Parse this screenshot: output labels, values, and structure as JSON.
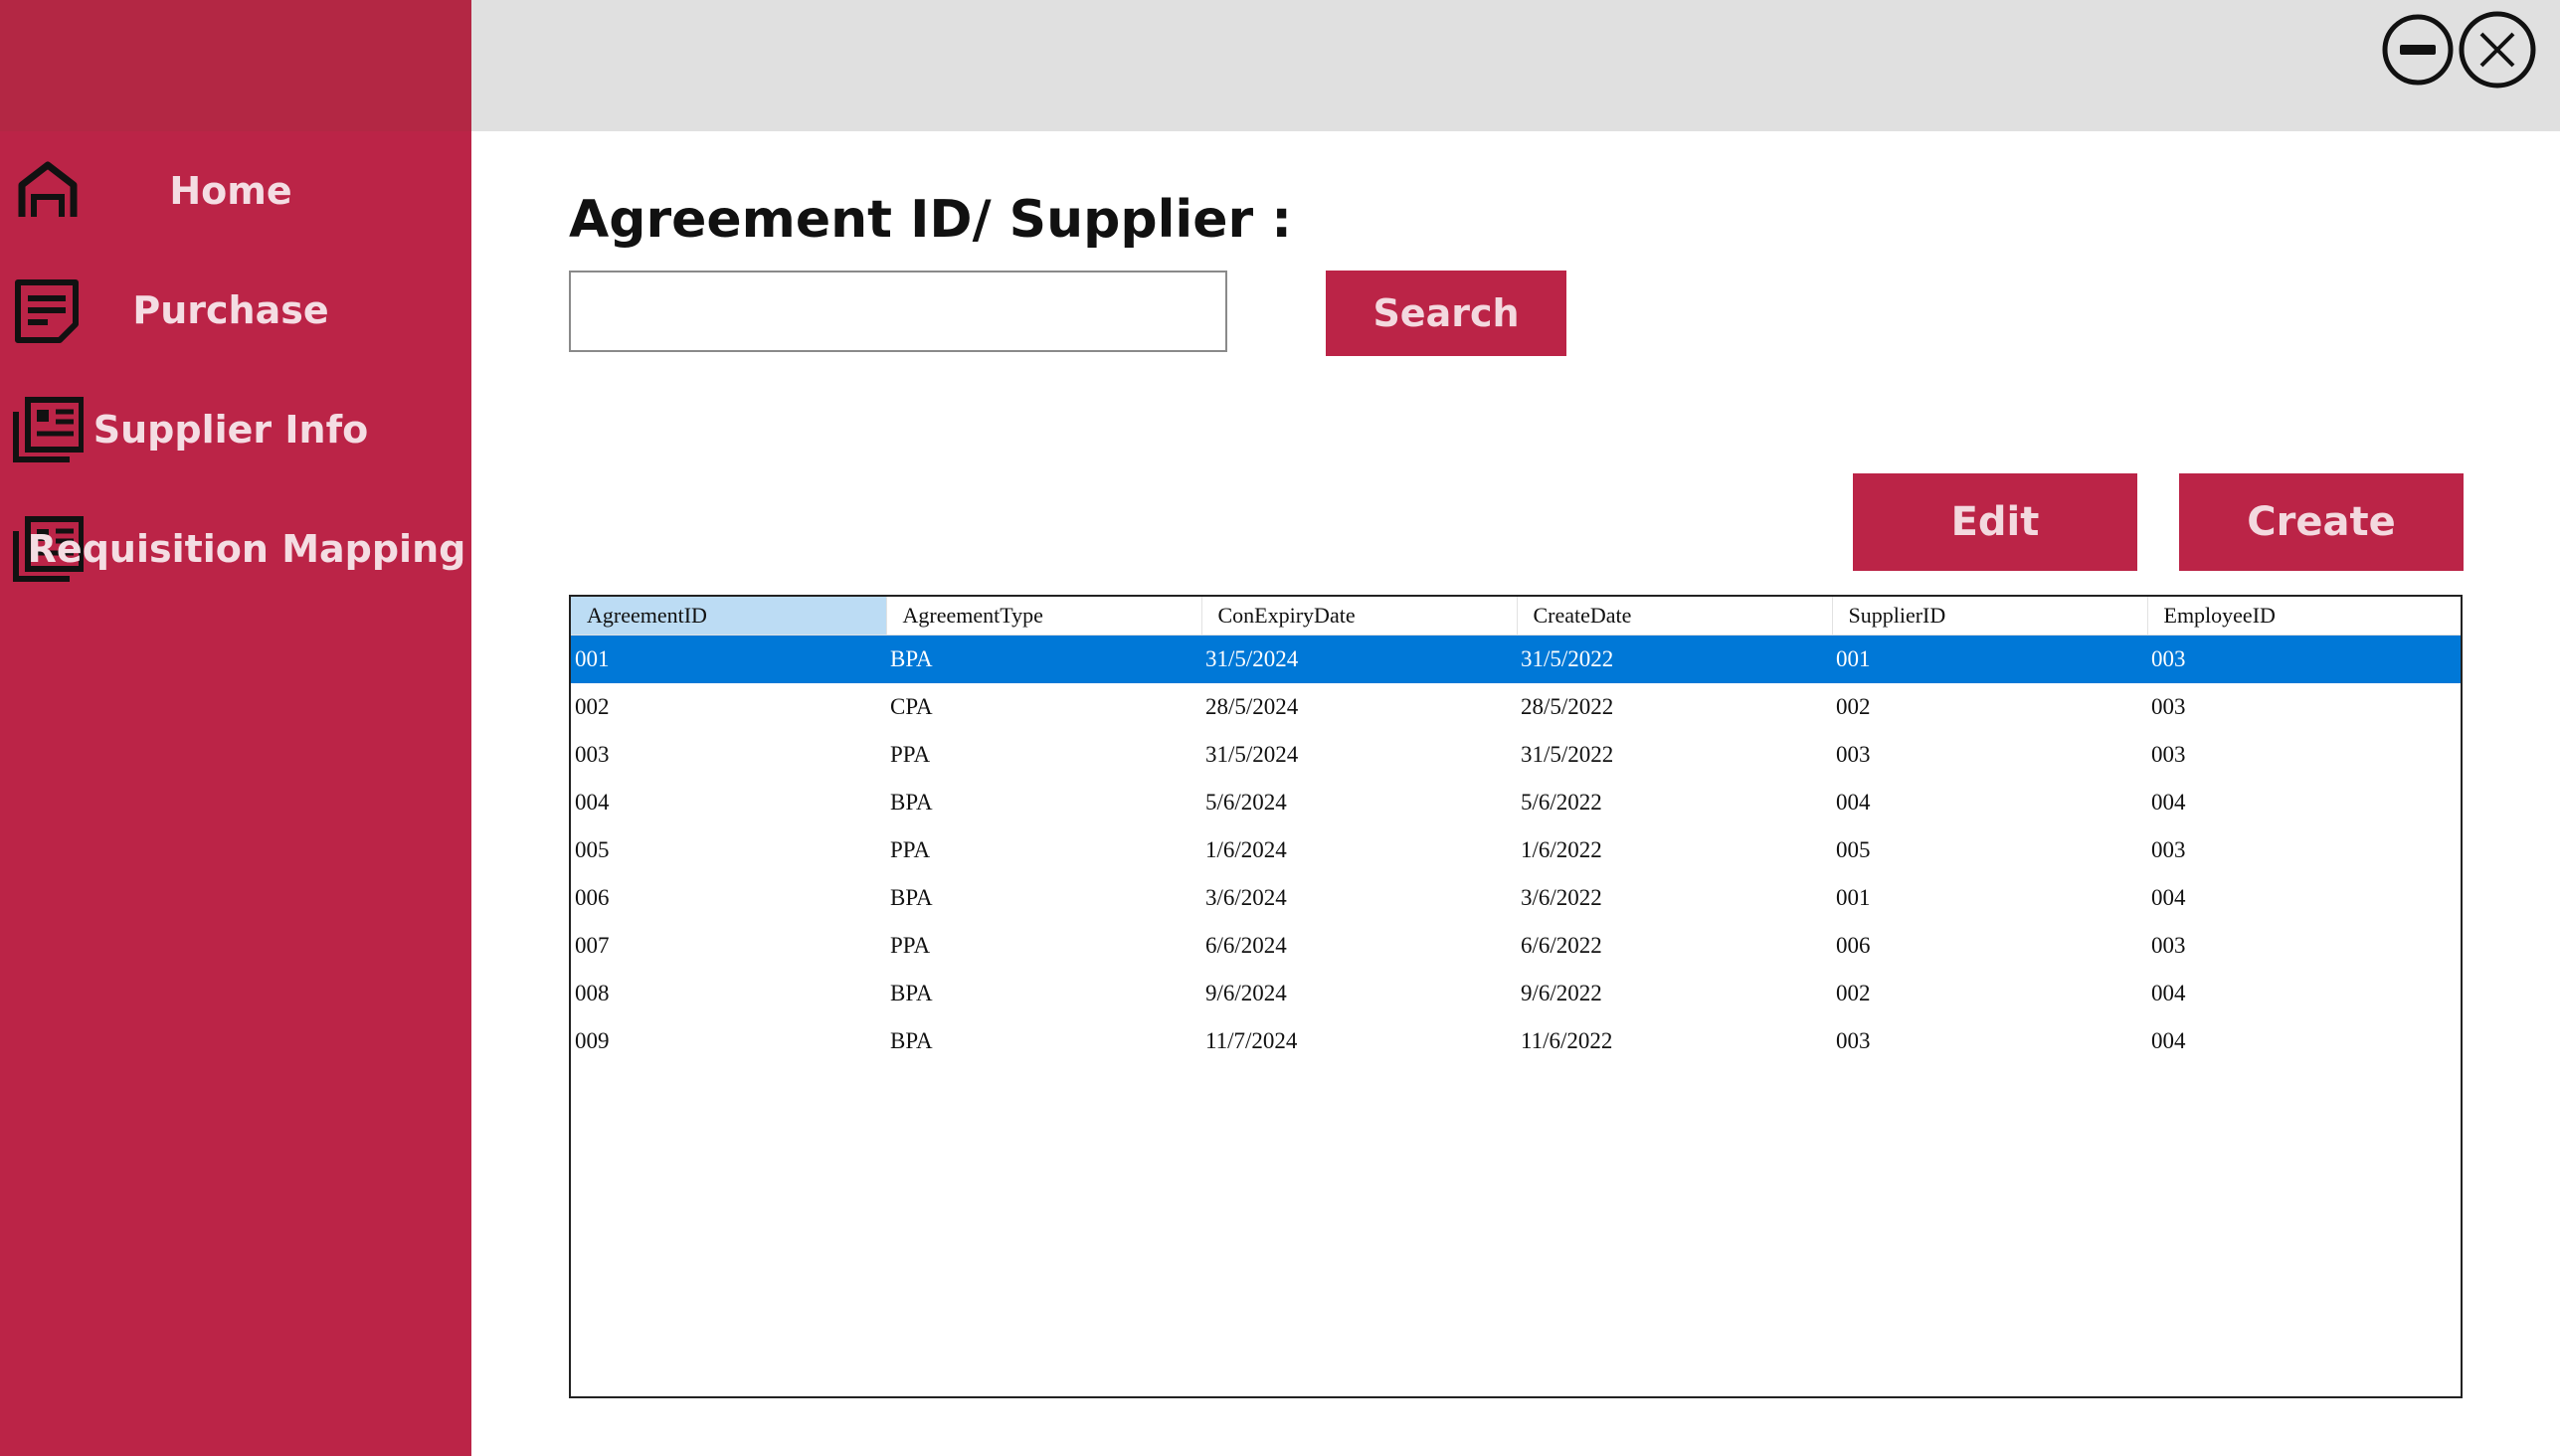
{
  "window_controls": {
    "minimize_icon": "minimize-circle-icon",
    "close_icon": "close-circle-icon"
  },
  "sidebar": {
    "items": [
      {
        "label": "Home",
        "icon": "home-icon"
      },
      {
        "label": "Purchase",
        "icon": "document-icon"
      },
      {
        "label": "Supplier Info",
        "icon": "newspaper-icon"
      },
      {
        "label": "Requisition Mapping",
        "icon": "newspaper-icon"
      }
    ]
  },
  "search": {
    "title": "Agreement ID/ Supplier :",
    "value": "",
    "placeholder": "",
    "button_label": "Search"
  },
  "actions": {
    "edit_label": "Edit",
    "create_label": "Create"
  },
  "colors": {
    "sidebar": "#bb2447",
    "topbar": "#e0e0e0",
    "selection": "#0078d7",
    "sorted_header": "#bcdcf4"
  },
  "grid": {
    "columns": [
      "AgreementID",
      "AgreementType",
      "ConExpiryDate",
      "CreateDate",
      "SupplierID",
      "EmployeeID"
    ],
    "selected_row": 0,
    "rows": [
      [
        "001",
        "BPA",
        "31/5/2024",
        "31/5/2022",
        "001",
        "003"
      ],
      [
        "002",
        "CPA",
        "28/5/2024",
        "28/5/2022",
        "002",
        "003"
      ],
      [
        "003",
        "PPA",
        "31/5/2024",
        "31/5/2022",
        "003",
        "003"
      ],
      [
        "004",
        "BPA",
        "5/6/2024",
        "5/6/2022",
        "004",
        "004"
      ],
      [
        "005",
        "PPA",
        "1/6/2024",
        "1/6/2022",
        "005",
        "003"
      ],
      [
        "006",
        "BPA",
        "3/6/2024",
        "3/6/2022",
        "001",
        "004"
      ],
      [
        "007",
        "PPA",
        "6/6/2024",
        "6/6/2022",
        "006",
        "003"
      ],
      [
        "008",
        "BPA",
        "9/6/2024",
        "9/6/2022",
        "002",
        "004"
      ],
      [
        "009",
        "BPA",
        "11/7/2024",
        "11/6/2022",
        "003",
        "004"
      ]
    ]
  }
}
